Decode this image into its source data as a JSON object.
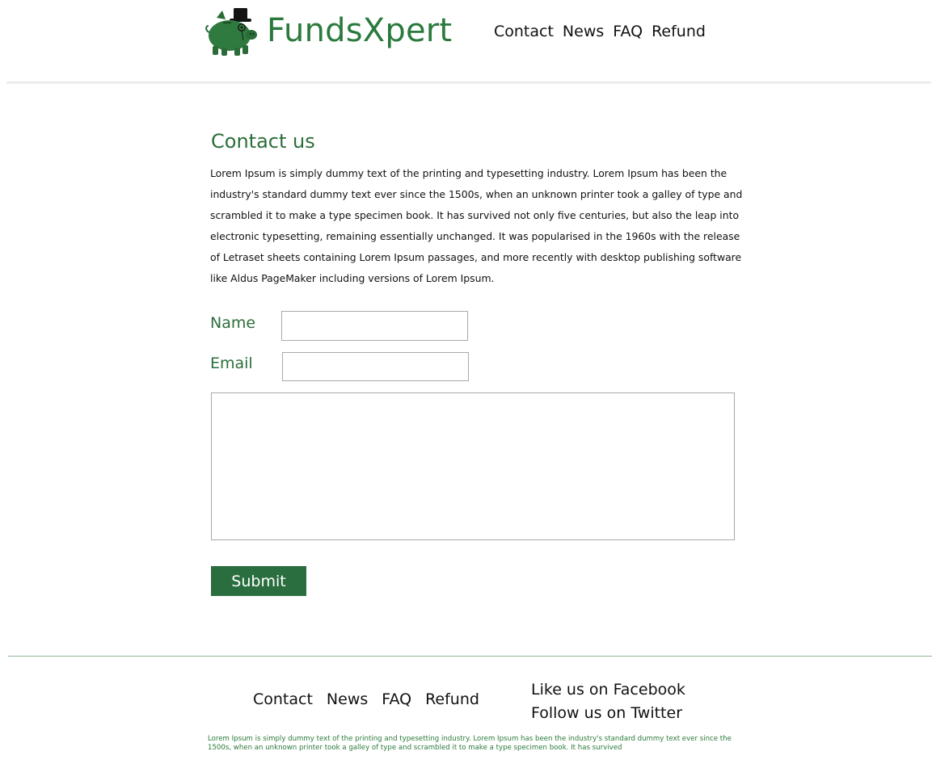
{
  "brand": {
    "name": "FundsXpert",
    "accent_color": "#2b7a3d",
    "logo_icon": "piggy-bank-top-hat-icon"
  },
  "header": {
    "nav": [
      {
        "label": "Contact"
      },
      {
        "label": "News"
      },
      {
        "label": "FAQ"
      },
      {
        "label": "Refund"
      }
    ]
  },
  "main": {
    "title": "Contact us",
    "intro": "Lorem Ipsum is simply dummy text of the printing and typesetting industry. Lorem Ipsum has been the industry's standard dummy text ever since the 1500s, when an unknown printer took a galley of type and scrambled it to make a type specimen book. It has survived not only five centuries, but also the leap into electronic typesetting, remaining essentially unchanged. It was popularised in the 1960s with the release of Letraset sheets containing Lorem Ipsum passages, and more recently with desktop publishing software like Aldus PageMaker including versions of Lorem Ipsum.",
    "form": {
      "name_label": "Name",
      "name_value": "",
      "email_label": "Email",
      "email_value": "",
      "message_value": "",
      "submit_label": "Submit",
      "submit_color": "#2a6e3f"
    }
  },
  "footer": {
    "nav": [
      {
        "label": "Contact"
      },
      {
        "label": "News"
      },
      {
        "label": "FAQ"
      },
      {
        "label": "Refund"
      }
    ],
    "social": {
      "facebook": "Like us on Facebook",
      "twitter": "Follow us on Twitter"
    },
    "text": "Lorem Ipsum is simply dummy text of the printing and typesetting industry. Lorem Ipsum has been the industry's standard dummy text ever since the 1500s, when an unknown printer took a galley of type and scrambled it to make a type specimen book. It has survived"
  }
}
